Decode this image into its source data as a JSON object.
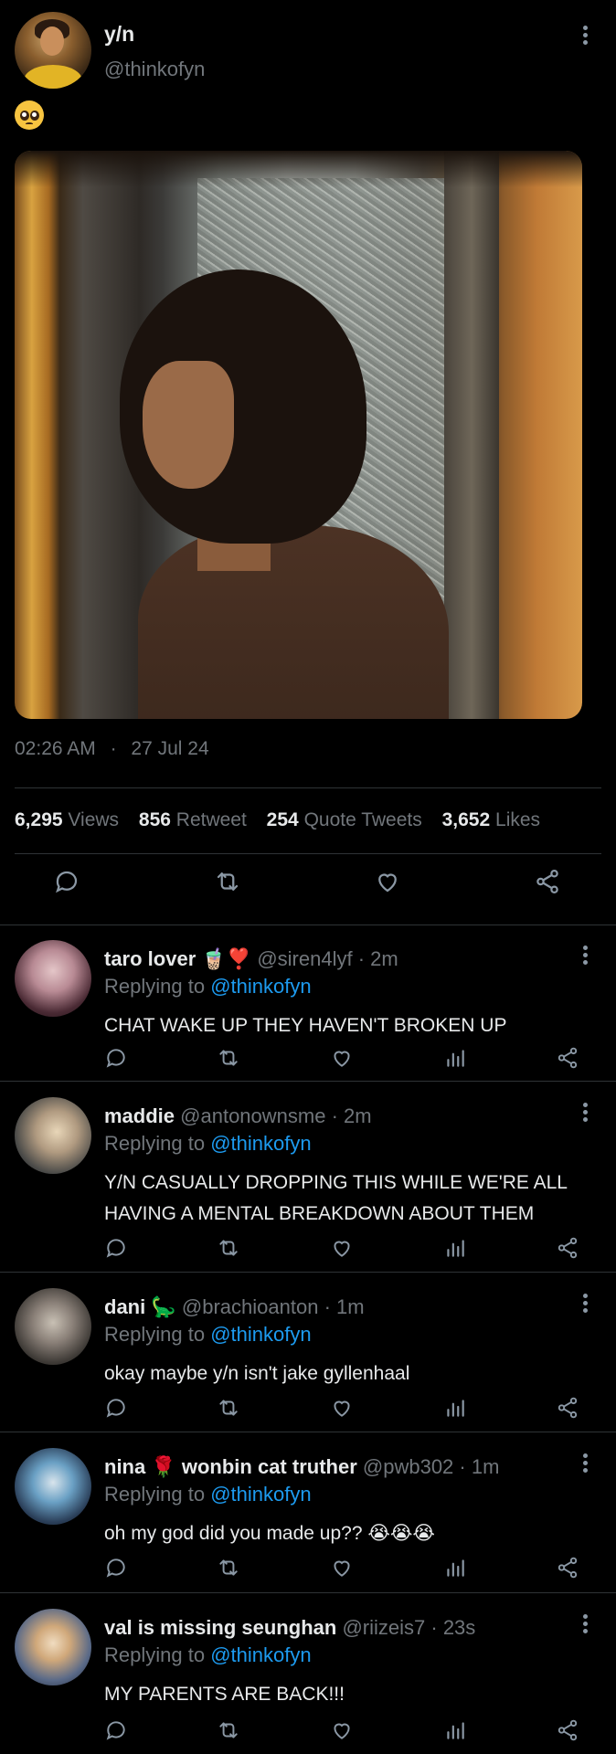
{
  "tweet": {
    "display_name": "y/n",
    "handle": "@thinkofyn",
    "emoji_icon": "pleading-face-emoji",
    "time": "02:26 AM",
    "separator": "·",
    "date": "27 Jul 24",
    "stats": [
      {
        "value": "6,295",
        "label": "Views"
      },
      {
        "value": "856",
        "label": "Retweet"
      },
      {
        "value": "254",
        "label": "Quote Tweets"
      },
      {
        "value": "3,652",
        "label": "Likes"
      }
    ]
  },
  "replying_label": "Replying to",
  "replying_handle": "@thinkofyn",
  "replies": [
    {
      "name": "taro lover",
      "name_suffix": "🧋❣️",
      "handle": "@siren4lyf",
      "age": "2m",
      "text": "CHAT WAKE UP THEY HAVEN'T BROKEN UP"
    },
    {
      "name": "maddie",
      "name_suffix": "",
      "handle": "@antonownsme",
      "age": "2m",
      "text": "Y/N CASUALLY DROPPING THIS WHILE WE'RE ALL HAVING A MENTAL BREAKDOWN ABOUT THEM"
    },
    {
      "name": "dani",
      "name_suffix": "🦕",
      "handle": "@brachioanton",
      "age": "1m",
      "text": "okay maybe y/n isn't jake gyllenhaal"
    },
    {
      "name": "nina",
      "name_suffix": "🌹 wonbin cat truther",
      "handle": "@pwb302",
      "age": "1m",
      "text": "oh my god did you made up?? 😭😭😭"
    },
    {
      "name": "val is missing seunghan",
      "name_suffix": "",
      "handle": "@riizeis7",
      "age": "23s",
      "text": "MY PARENTS ARE BACK!!!"
    }
  ],
  "colors": {
    "background": "#000000",
    "text": "#e7e9ea",
    "muted": "#71767b",
    "link": "#1d9bf0",
    "divider": "#2f3336"
  }
}
